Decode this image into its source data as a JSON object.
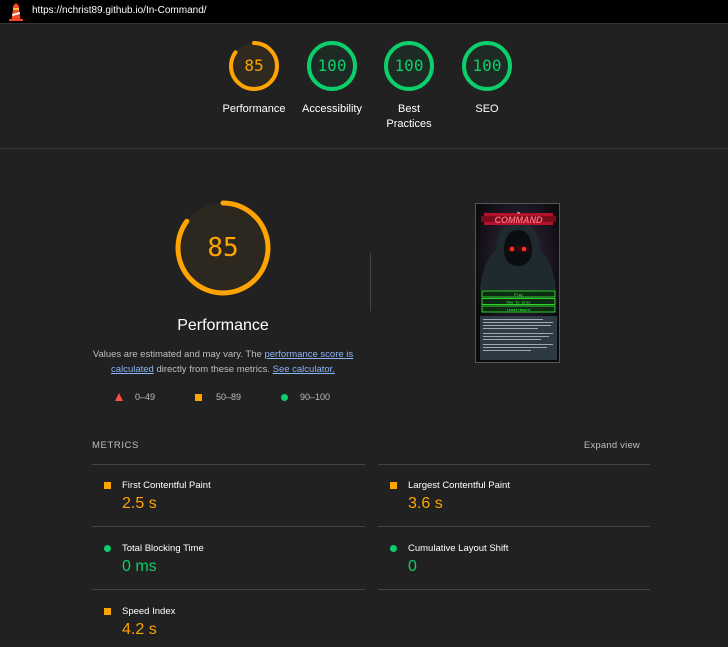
{
  "header": {
    "url": "https://nchrist89.github.io/In-Command/"
  },
  "colors": {
    "pass": "#0cce6b",
    "average": "#ffa400",
    "fail": "#ff4e42",
    "background": "#212121"
  },
  "gauges": [
    {
      "score": "85",
      "value": 0.85,
      "label": "Performance",
      "color": "#ffa400"
    },
    {
      "score": "100",
      "value": 1.0,
      "label": "Accessibility",
      "color": "#0cce6b"
    },
    {
      "score": "100",
      "value": 1.0,
      "label": "Best Practices",
      "color": "#0cce6b"
    },
    {
      "score": "100",
      "value": 1.0,
      "label": "SEO",
      "color": "#0cce6b"
    }
  ],
  "performance": {
    "score": "85",
    "value": 0.85,
    "title": "Performance",
    "desc_prefix": "Values are estimated and may vary. The ",
    "desc_link1": "performance score is calculated",
    "desc_middle": " directly from these metrics. ",
    "desc_link2": "See calculator."
  },
  "legend": [
    {
      "shape": "triangle",
      "range": "0–49"
    },
    {
      "shape": "square",
      "range": "50–89"
    },
    {
      "shape": "circle",
      "range": "90–100"
    }
  ],
  "screenshot": {
    "logo_text": "COMMAND",
    "logo_small": "In",
    "buttons": [
      "Play",
      "How to play",
      "Leaderboard"
    ]
  },
  "metrics": {
    "title": "METRICS",
    "expand_label": "Expand view",
    "items": [
      {
        "label": "First Contentful Paint",
        "value": "2.5 s",
        "rating": "average",
        "icon": "orange-square-icon"
      },
      {
        "label": "Largest Contentful Paint",
        "value": "3.6 s",
        "rating": "average",
        "icon": "orange-square-icon"
      },
      {
        "label": "Total Blocking Time",
        "value": "0 ms",
        "rating": "pass",
        "icon": "green-circle-icon"
      },
      {
        "label": "Cumulative Layout Shift",
        "value": "0",
        "rating": "pass",
        "icon": "green-circle-icon"
      },
      {
        "label": "Speed Index",
        "value": "4.2 s",
        "rating": "average",
        "icon": "orange-square-icon"
      }
    ]
  }
}
